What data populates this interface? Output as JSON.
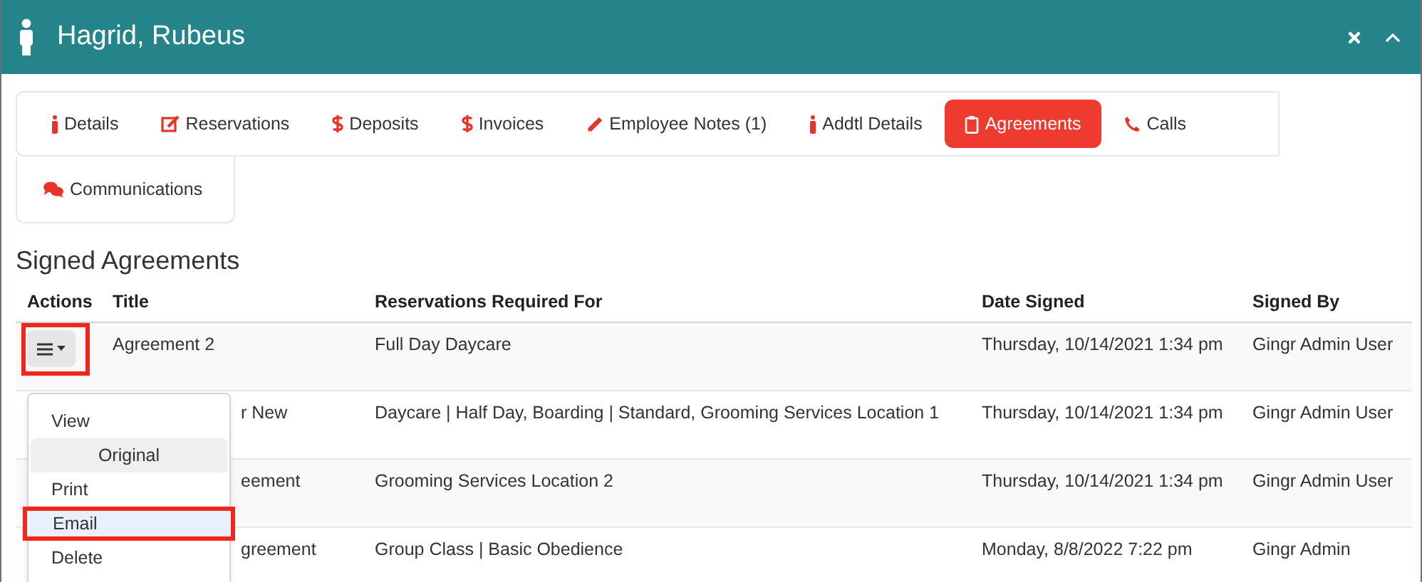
{
  "window": {
    "title": "Hagrid, Rubeus"
  },
  "tabs": [
    {
      "label": "Details",
      "selected": false
    },
    {
      "label": "Reservations",
      "selected": false
    },
    {
      "label": "Deposits",
      "selected": false
    },
    {
      "label": "Invoices",
      "selected": false
    },
    {
      "label": "Employee Notes (1)",
      "selected": false
    },
    {
      "label": "Addtl Details",
      "selected": false
    },
    {
      "label": "Agreements",
      "selected": true
    },
    {
      "label": "Calls",
      "selected": false
    },
    {
      "label": "Communications",
      "selected": false
    }
  ],
  "actions_button": {
    "annotated": true
  },
  "section_title": "Signed Agreements",
  "table": {
    "columns": [
      "Actions",
      "Title",
      "Reservations Required For",
      "Date Signed",
      "Signed By"
    ],
    "rows": [
      {
        "title": "Agreement 2",
        "reservations": "Full Day Daycare",
        "date_signed": "Thursday, 10/14/2021 1:34 pm",
        "signed_by": "Gingr Admin User"
      },
      {
        "title": "r New",
        "reservations": "Daycare | Half Day, Boarding | Standard, Grooming Services Location 1",
        "date_signed": "Thursday, 10/14/2021 1:34 pm",
        "signed_by": "Gingr Admin User"
      },
      {
        "title": "eement",
        "reservations": "Grooming Services Location 2",
        "date_signed": "Thursday, 10/14/2021 1:34 pm",
        "signed_by": "Gingr Admin User"
      },
      {
        "title": "greement",
        "reservations": "Group Class | Basic Obedience",
        "date_signed": "Monday, 8/8/2022 7:22 pm",
        "signed_by": "Gingr Admin"
      }
    ]
  },
  "actions_menu": [
    {
      "label": "View",
      "kind": "item",
      "selected": false,
      "annotated": false
    },
    {
      "label": "Original",
      "kind": "subitem",
      "selected": false,
      "annotated": false
    },
    {
      "label": "Print",
      "kind": "item",
      "selected": false,
      "annotated": false
    },
    {
      "label": "Email",
      "kind": "item",
      "selected": true,
      "annotated": true
    },
    {
      "label": "Delete",
      "kind": "item",
      "selected": false,
      "annotated": false
    }
  ]
}
